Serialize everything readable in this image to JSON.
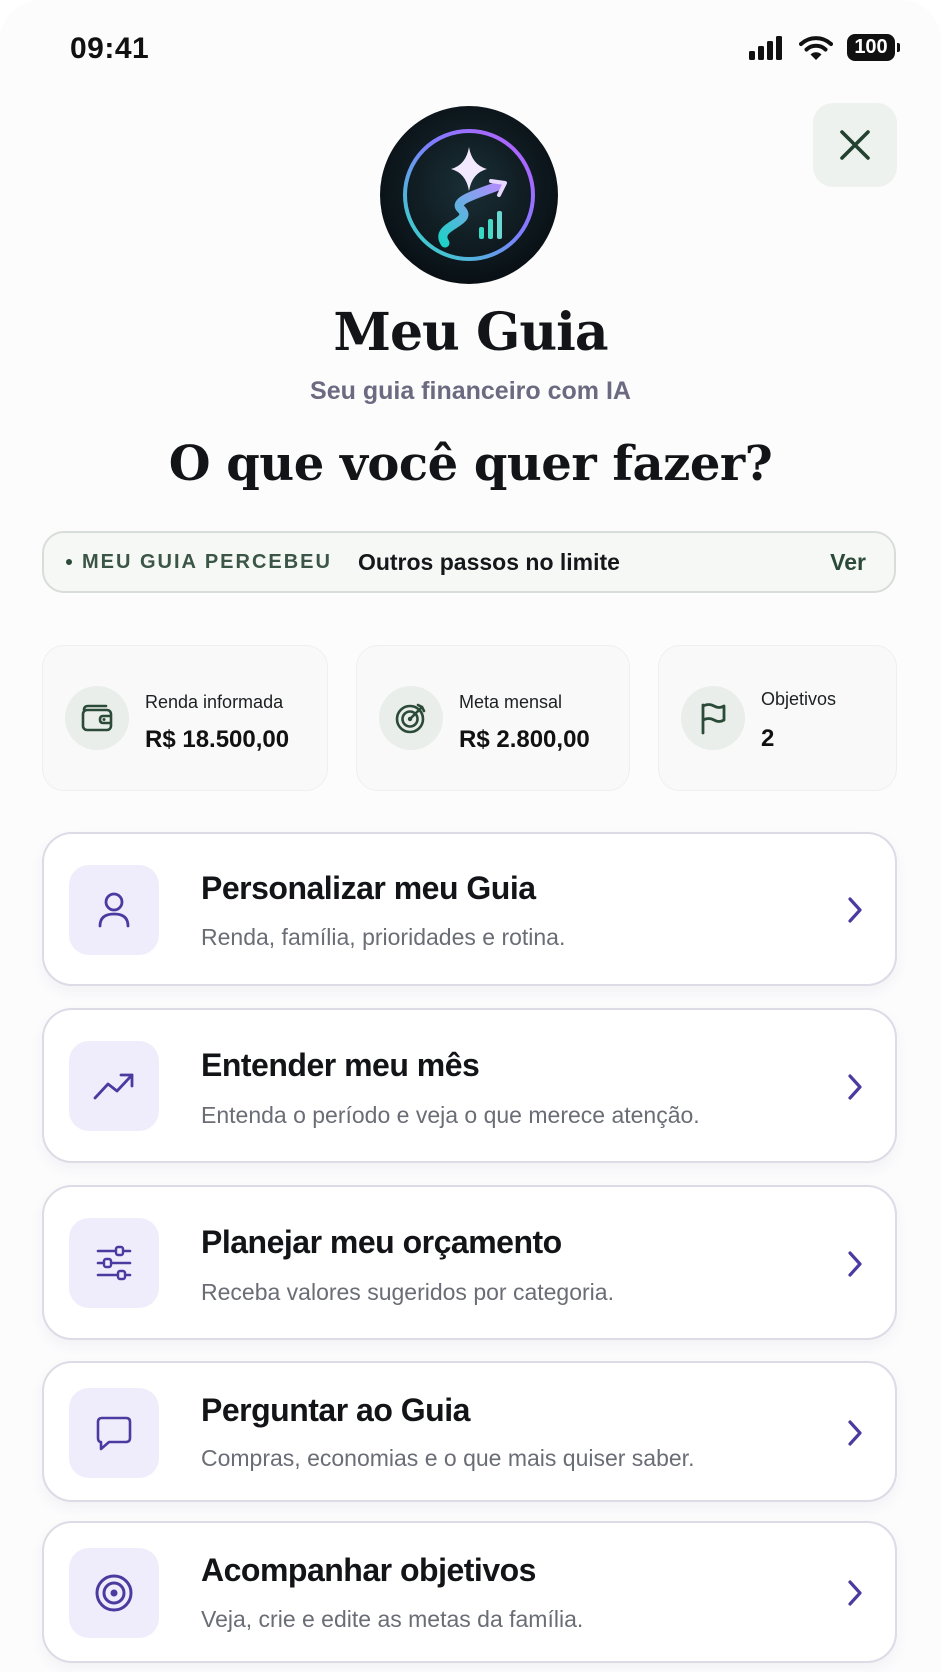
{
  "status": {
    "time": "09:41",
    "battery": "100"
  },
  "header": {
    "title": "Meu Guia",
    "subtitle": "Seu guia financeiro com IA",
    "question": "O que você quer fazer?"
  },
  "insight": {
    "tag": "MEU GUIA PERCEBEU",
    "text": "Outros passos no limite",
    "link": "Ver"
  },
  "stats": [
    {
      "label": "Renda informada",
      "value": "R$ 18.500,00",
      "icon": "wallet-icon"
    },
    {
      "label": "Meta mensal",
      "value": "R$ 2.800,00",
      "icon": "target-icon"
    },
    {
      "label": "Objetivos",
      "value": "2",
      "icon": "flag-icon"
    }
  ],
  "actions": [
    {
      "title": "Personalizar meu Guia",
      "description": "Renda, família, prioridades e rotina.",
      "icon": "user-icon"
    },
    {
      "title": "Entender meu mês",
      "description": "Entenda o período e veja o que merece atenção.",
      "icon": "trend-up-icon"
    },
    {
      "title": "Planejar meu orçamento",
      "description": "Receba valores sugeridos por categoria.",
      "icon": "sliders-icon"
    },
    {
      "title": "Perguntar ao Guia",
      "description": "Compras, economias e o que mais quiser saber.",
      "icon": "chat-icon"
    },
    {
      "title": "Acompanhar objetivos",
      "description": "Veja, crie e edite as metas da família.",
      "icon": "goal-target-icon"
    }
  ],
  "colors": {
    "accent_green": "#2b4a37",
    "accent_purple": "#4b3aa0",
    "icon_tile": "#efedfb",
    "card_border": "#dcdbe6"
  }
}
